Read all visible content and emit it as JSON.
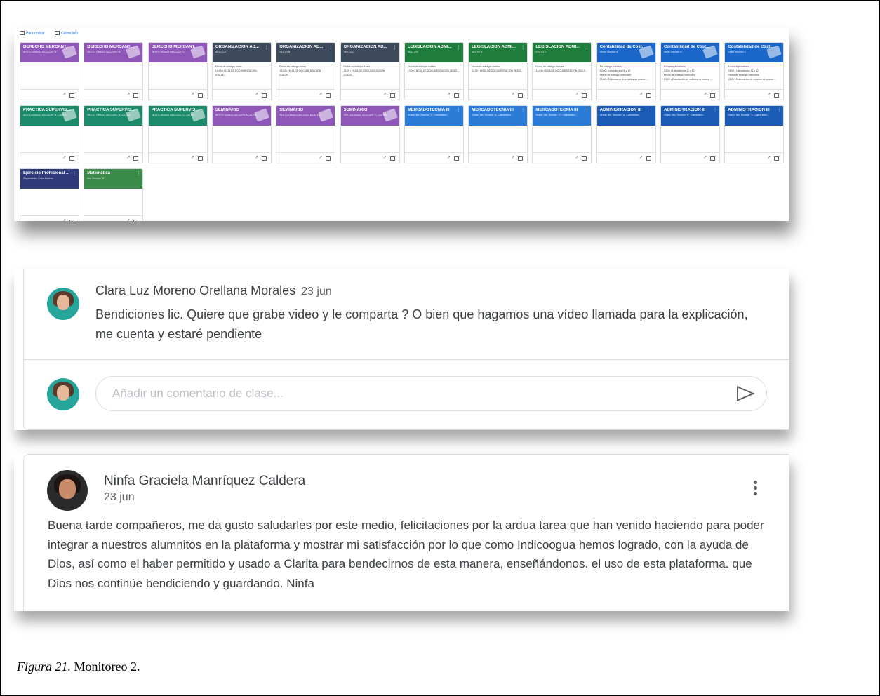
{
  "top_bar": {
    "todo_label": "Para revisar",
    "calendar_label": "Calendario"
  },
  "courses": [
    {
      "title": "DERECHO MERCANT...",
      "subtitle": "SEXTO GRADO SECCIÓN \"A\"",
      "color": "#8e57b8",
      "deco": true,
      "lines": []
    },
    {
      "title": "DERECHO MERCANT...",
      "subtitle": "SEXTO GRADO SECCIÓN \"B\"",
      "color": "#8e57b8",
      "deco": true,
      "lines": []
    },
    {
      "title": "DERECHO MERCANT...",
      "subtitle": "SEXTO GRADO SECCIÓN \"C\"",
      "color": "#8e57b8",
      "deco": true,
      "lines": []
    },
    {
      "title": "ORGANIZACIÓN AD...",
      "subtitle": "SEXTO A",
      "color": "#3c4a5c",
      "deco": false,
      "lines": [
        "Fecha de entrega: lunes",
        "13:00 • HOJA DE DOCUMENTACIÓN (CALLE..."
      ]
    },
    {
      "title": "ORGANIZACIÓN AD...",
      "subtitle": "SEXTO B",
      "color": "#3c4a5c",
      "deco": false,
      "lines": [
        "Fecha de entrega: lunes",
        "13:00 • HOJA DE DOCUMENTACIÓN (CALLE..."
      ]
    },
    {
      "title": "ORGANIZACIÓN AD...",
      "subtitle": "SEXTO C",
      "color": "#3c4a5c",
      "deco": false,
      "lines": [
        "Fecha de entrega: lunes",
        "13:00 • HOJA DE DOCUMENTACIÓN (CALLE..."
      ]
    },
    {
      "title": "LEGISLACIÓN ADMI...",
      "subtitle": "SEXTO A",
      "color": "#1e7d3c",
      "deco": false,
      "lines": [
        "Fecha de entrega: martes",
        "13:00 • HOJA DE DOCUMENTACIÓN (BOLS..."
      ]
    },
    {
      "title": "LEGISLACIÓN ADMI...",
      "subtitle": "SEXTO B",
      "color": "#1e7d3c",
      "deco": false,
      "lines": [
        "Fecha de entrega: martes",
        "13:00 • HOJA DE DOCUMENTACIÓN (BOLS..."
      ]
    },
    {
      "title": "LEGISLACIÓN ADMI...",
      "subtitle": "SEXTO C",
      "color": "#1e7d3c",
      "deco": false,
      "lines": [
        "Fecha de entrega: martes",
        "13:00 • HOJA DE DOCUMENTACIÓN (BOLS..."
      ]
    },
    {
      "title": "Contabilidad de Cost...",
      "subtitle": "Sexto Sección A",
      "color": "#1a66c9",
      "deco": true,
      "lines": [
        "En entrega mañana",
        "13:00 • Laboratorios 11 y 12",
        "Fecha de entrega: miércoles",
        "13:00 • Elaboración de estados de costos ..."
      ]
    },
    {
      "title": "Contabilidad de Cost...",
      "subtitle": "Sexto Sección B",
      "color": "#1a66c9",
      "deco": true,
      "lines": [
        "En entrega mañana",
        "13:00 • Laboratorios 11 y 12",
        "Fecha de entrega: miércoles",
        "13:00 • Elaboración de estados de costos ..."
      ]
    },
    {
      "title": "Contabilidad de Cost...",
      "subtitle": "Sexto Sección C",
      "color": "#1a66c9",
      "deco": true,
      "lines": [
        "En entrega mañana",
        "13:00 • Laboratorios 11 y 12",
        "Fecha de entrega: miércoles",
        "13:00 • Elaboración de estados de costos ..."
      ]
    },
    {
      "title": "PRACTICA SUPERVIS...",
      "subtitle": "SEXTO GRADO SECCIÓN \"A\" CATEG...",
      "color": "#1b8a6b",
      "deco": true,
      "lines": []
    },
    {
      "title": "PRACTICA SUPERVIS...",
      "subtitle": "SEXTO GRADO SECCIÓN \"B\" CATEG...",
      "color": "#1b8a6b",
      "deco": true,
      "lines": []
    },
    {
      "title": "PRACTICA SUPERVIS...",
      "subtitle": "SEXTO GRADO SECCIÓN \"C\" CATEG...",
      "color": "#1b8a6b",
      "deco": true,
      "lines": []
    },
    {
      "title": "SEMINARIO",
      "subtitle": "SEXTO GRADO SECCIÓN A CATEG...",
      "color": "#8e57b8",
      "deco": true,
      "lines": []
    },
    {
      "title": "SEMINARIO",
      "subtitle": "SEXTO GRADO SECCIÓN B CATEG...",
      "color": "#8e57b8",
      "deco": true,
      "lines": []
    },
    {
      "title": "SEMINARIO",
      "subtitle": "SEXTO GRADO SECCIÓN \"C\" CATEG...",
      "color": "#8e57b8",
      "deco": true,
      "lines": []
    },
    {
      "title": "MERCADOTECNIA III",
      "subtitle": "Grado: 6to. Sección \"A\" Catedrático...",
      "color": "#2b7bd6",
      "deco": false,
      "lines": []
    },
    {
      "title": "MERCADOTECNIA III",
      "subtitle": "Grado: 6to. Sección \"B\" Catedrático...",
      "color": "#2b7bd6",
      "deco": false,
      "lines": []
    },
    {
      "title": "MERCADOTECNIA III",
      "subtitle": "Grado: 6to. Sección \"C\" Catedrático...",
      "color": "#2b7bd6",
      "deco": false,
      "lines": []
    },
    {
      "title": "ADMINISTRACIÓN III",
      "subtitle": "Grado: 6to. Sección \"A\" Catedrático...",
      "color": "#1a5bb5",
      "deco": false,
      "lines": []
    },
    {
      "title": "ADMINISTRACIÓN III",
      "subtitle": "Grado: 6to. Sección \"B\" Catedrático...",
      "color": "#1a5bb5",
      "deco": false,
      "lines": []
    },
    {
      "title": "ADMINISTRACIÓN III",
      "subtitle": "Grado: 6to. Sección \"C\" Catedrático...",
      "color": "#1a5bb5",
      "deco": false,
      "lines": []
    },
    {
      "title": "Ejercicio Profesional ...",
      "subtitle": "Seguimiento: Clara Moreno",
      "color": "#2e3a7a",
      "deco": false,
      "lines": []
    },
    {
      "title": "Matemática I",
      "subtitle": "6to. Sección \"B\"",
      "color": "#3a8a4a",
      "deco": false,
      "lines": []
    }
  ],
  "comment": {
    "author": "Clara Luz Moreno Orellana Morales",
    "date": "23 jun",
    "text": "Bendiciones lic. Quiere que grabe video y le comparta ? O bien que hagamos una vídeo llamada para la explicación, me cuenta y estaré pendiente",
    "input_placeholder": "Añadir un comentario de clase..."
  },
  "post": {
    "author": "Ninfa Graciela Manríquez Caldera",
    "date": "23 jun",
    "text": "Buena tarde compañeros, me da gusto saludarles por este medio, felicitaciones por la ardua tarea que han venido haciendo para poder integrar a nuestros alumnitos en la plataforma y mostrar mi satisfacción por lo que como Indicoogua hemos logrado, con la ayuda de Dios, así como el haber permitido y usado a Clarita para bendecirnos de esta manera, enseñándonos. el uso de esta plataforma. que Dios nos continúe bendiciendo y guardando. Ninfa"
  },
  "caption": {
    "label": "Figura 21.",
    "text": " Monitoreo 2."
  }
}
